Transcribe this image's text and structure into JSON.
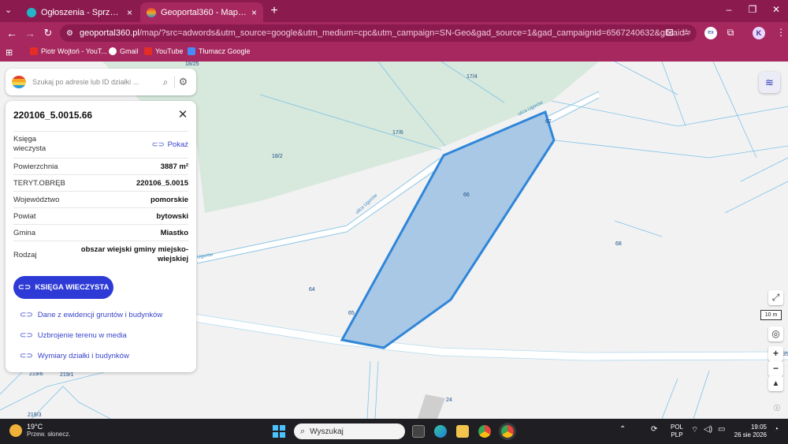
{
  "browser": {
    "tabs": [
      {
        "title": "Ogłoszenia - Sprzedam, kupię",
        "active": false
      },
      {
        "title": "Geoportal360 - Mapa Interakty",
        "active": true
      }
    ],
    "url_domain": "geoportal360.pl",
    "url_rest": "/map/?src=adwords&utm_source=google&utm_medium=cpc&utm_campaign=SN-Geo&gad_source=1&gad_campaignid=6567240632&gbraid=0AAAAACorlzn1sq...",
    "profile_initial": "K",
    "bookmarks": [
      "Piotr Wojtoń - YouT...",
      "Gmail",
      "YouTube",
      "Tłumacz Google"
    ],
    "colors": {
      "frame": "#8b1b4f",
      "toolbar": "#a6285e"
    }
  },
  "search": {
    "placeholder": "Szukaj po adresie lub ID działki ..."
  },
  "parcel_panel": {
    "title": "220106_5.0015.66",
    "rows": [
      {
        "key": "Księga wieczysta",
        "value": "Pokaż",
        "is_link": true
      },
      {
        "key": "Powierzchnia",
        "value": "3887 m²"
      },
      {
        "key": "TERYT.OBRĘB",
        "value": "220106_5.0015"
      },
      {
        "key": "Województwo",
        "value": "pomorskie"
      },
      {
        "key": "Powiat",
        "value": "bytowski"
      },
      {
        "key": "Gmina",
        "value": "Miastko"
      },
      {
        "key": "Rodzaj",
        "value": "obszar wiejski gminy miejsko-wiejskiej"
      }
    ],
    "button_label": "KSIĘGA WIECZYSTA",
    "links": [
      "Dane z ewidencji gruntów i budynków",
      "Uzbrojenie terenu w media",
      "Wymiary działki i budynków"
    ],
    "accent_color": "#2e3ad6"
  },
  "map": {
    "plot_labels": [
      "18/25",
      "17/4",
      "17/6",
      "18/2",
      "66",
      "67",
      "68",
      "64",
      "65",
      "219/6",
      "219/1",
      "219/3",
      "95",
      "24"
    ],
    "street_labels": [
      "ulica Ugorów",
      "ulica Ugorów",
      "Ugorów"
    ],
    "scale_label": "10 m",
    "selection_color": "#2f86d8"
  },
  "taskbar": {
    "temperature": "19°C",
    "weather": "Przew. słonecz.",
    "search_label": "Wyszukaj",
    "lang_top": "POL",
    "lang_bottom": "PLP",
    "time": "19:05",
    "date": "26 sie 2026"
  }
}
